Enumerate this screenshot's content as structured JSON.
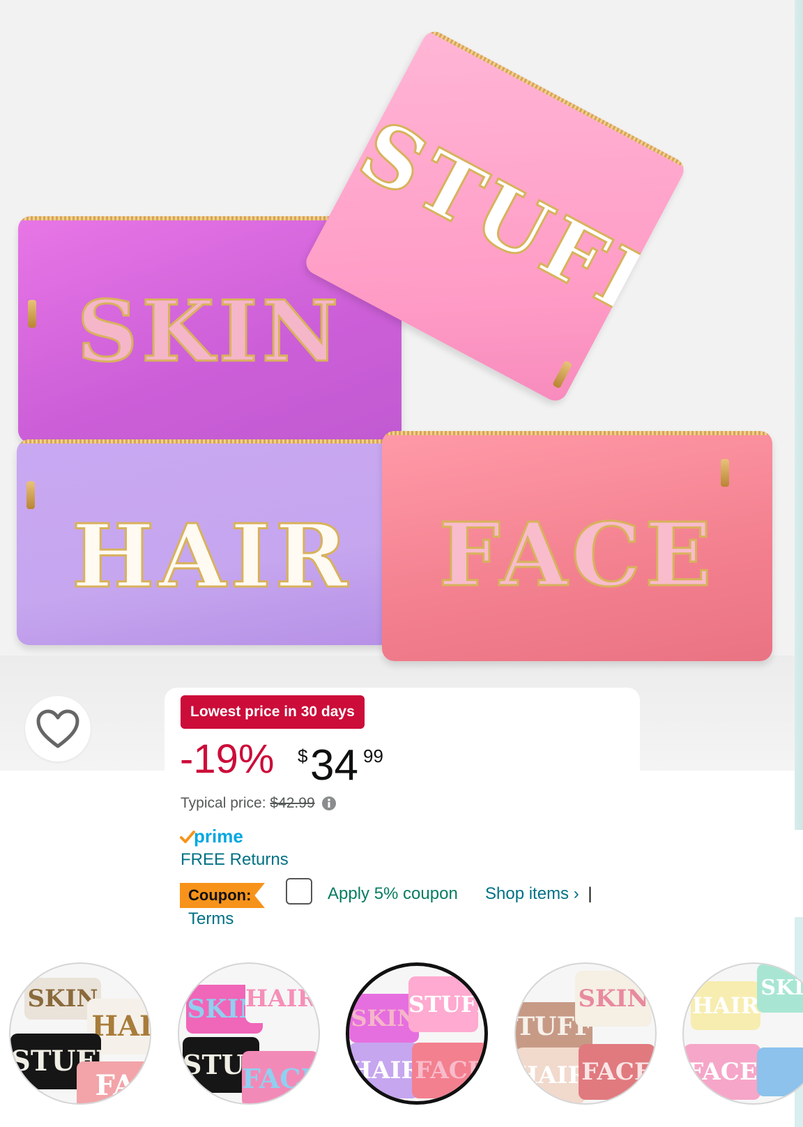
{
  "product_image": {
    "pouches": [
      "SKIN",
      "STUFF",
      "HAIR",
      "FACE"
    ]
  },
  "wishlist": {
    "icon": "heart-icon"
  },
  "price": {
    "badge": "Lowest price in 30 days",
    "discount": "-19%",
    "currency": "$",
    "whole": "34",
    "fraction": "99",
    "typical_label": "Typical price:",
    "typical_value": "$42.99",
    "info_icon": "info-icon"
  },
  "prime": {
    "label": "prime"
  },
  "returns": {
    "label": "FREE Returns"
  },
  "coupon": {
    "tag": "Coupon:",
    "apply_label": "Apply 5% coupon",
    "shop_items": "Shop items ›",
    "separator": "|",
    "terms": "Terms",
    "checked": false
  },
  "thumbnails": {
    "items": [
      {
        "texts": [
          "SKIN",
          "HAI",
          "STUFF",
          "FA"
        ]
      },
      {
        "texts": [
          "SKIN",
          "HAIR",
          "STUFF",
          "FACE"
        ]
      },
      {
        "texts": [
          "SKIN",
          "STUFF",
          "HAIR",
          "FACE"
        ]
      },
      {
        "texts": [
          "TUFF",
          "SKIN",
          "HAIR",
          "FACE"
        ]
      },
      {
        "texts": [
          "HAIR",
          "SKIN",
          "FACE"
        ]
      }
    ],
    "selected_index": 2
  },
  "colors": {
    "deal_red": "#cc0c39",
    "link_teal": "#007185",
    "coupon_green": "#067d62",
    "coupon_orange": "#f7931a",
    "prime_blue": "#00a8e1"
  }
}
